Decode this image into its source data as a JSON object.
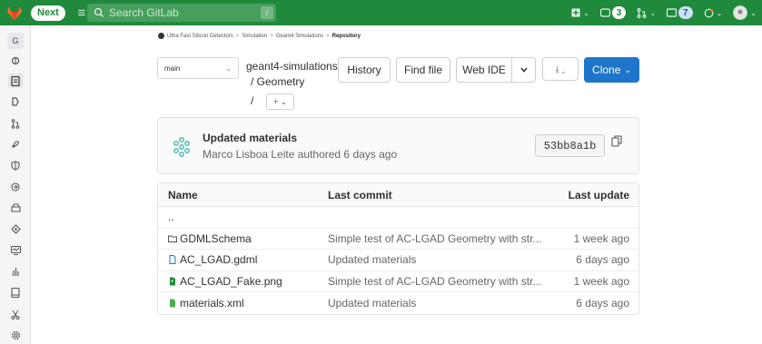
{
  "topbar": {
    "next_label": "Next",
    "search_placeholder": "Search GitLab",
    "search_shortcut": "/",
    "issues_count": "3",
    "todos_count": "7"
  },
  "sidebar": {
    "project_initial": "G",
    "items": [
      "project-overview",
      "repository",
      "issues",
      "merge-requests",
      "ci-cd",
      "security",
      "deployments",
      "packages",
      "infrastructure",
      "monitor",
      "analytics",
      "wiki",
      "snippets",
      "settings"
    ]
  },
  "breadcrumb": {
    "items": [
      "Ultra Fast Silicon Detectors",
      "Simulation",
      "Geant4 Simulations"
    ],
    "current": "Repository",
    "separator": ">"
  },
  "toolbar": {
    "branch": "main",
    "path_root": "geant4-simulations",
    "path_sep1": "/ Geometry",
    "path_sep2": "/",
    "plus_label": "+ ⌄",
    "history": "History",
    "find_file": "Find file",
    "web_ide": "Web IDE",
    "clone": "Clone",
    "download_label": "⤓ ⌄"
  },
  "commit": {
    "title": "Updated materials",
    "meta": "Marco Lisboa Leite authored 6 days ago",
    "sha": "53bb8a1b"
  },
  "table": {
    "headers": {
      "name": "Name",
      "last_commit": "Last commit",
      "last_update": "Last update"
    },
    "parent": "..",
    "rows": [
      {
        "name": "GDMLSchema",
        "type": "folder",
        "commit": "Simple test of AC-LGAD Geometry with str...",
        "updated": "1 week ago"
      },
      {
        "name": "AC_LGAD.gdml",
        "type": "file",
        "commit": "Updated materials",
        "updated": "6 days ago"
      },
      {
        "name": "AC_LGAD_Fake.png",
        "type": "image",
        "commit": "Simple test of AC-LGAD Geometry with str...",
        "updated": "1 week ago"
      },
      {
        "name": "materials.xml",
        "type": "xml",
        "commit": "Updated materials",
        "updated": "6 days ago"
      }
    ]
  },
  "colors": {
    "topbar": "#1f8a3b",
    "primary_button": "#1f75cb",
    "folder_icon": "#555555",
    "file_icon": "#1f75cb",
    "image_icon": "#1f8a3b",
    "xml_icon": "#4caf50"
  }
}
